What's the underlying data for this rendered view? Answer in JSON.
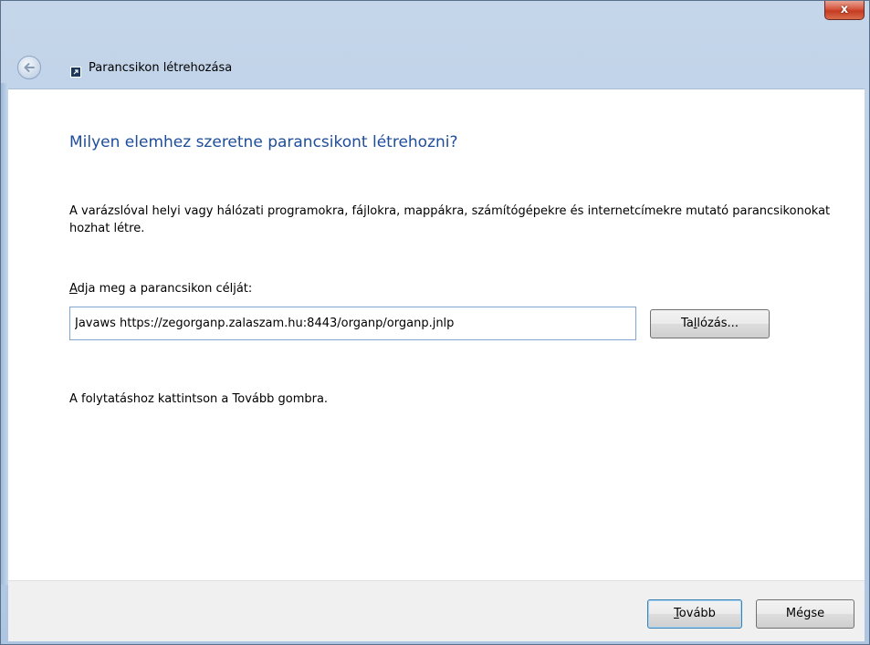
{
  "window": {
    "close_label": "x"
  },
  "nav": {
    "title": "Parancsikon létrehozása",
    "back_icon": "back-arrow-icon",
    "app_icon": "shortcut-icon"
  },
  "main": {
    "heading": "Milyen elemhez szeretne parancsikont létrehozni?",
    "description": "A varázslóval helyi vagy hálózati programokra, fájlokra, mappákra, számítógépekre és internetcímekre mutató parancsikonokat hozhat létre.",
    "field_label_accel": "A",
    "field_label_rest": "dja meg a parancsikon célját:",
    "target_value": "Javaws https://zegorganp.zalaszam.hu:8443/organp/organp.jnlp",
    "browse_pre": "Ta",
    "browse_accel": "l",
    "browse_post": "lózás...",
    "hint": "A folytatáshoz kattintson a Tovább gombra."
  },
  "footer": {
    "next_accel": "T",
    "next_rest": "ovább",
    "cancel_label": "Mégse"
  },
  "colors": {
    "heading": "#1e4d9b",
    "close_button": "#c53c21",
    "input_border": "#7fa5d0",
    "default_button_border": "#3c7fb1"
  }
}
